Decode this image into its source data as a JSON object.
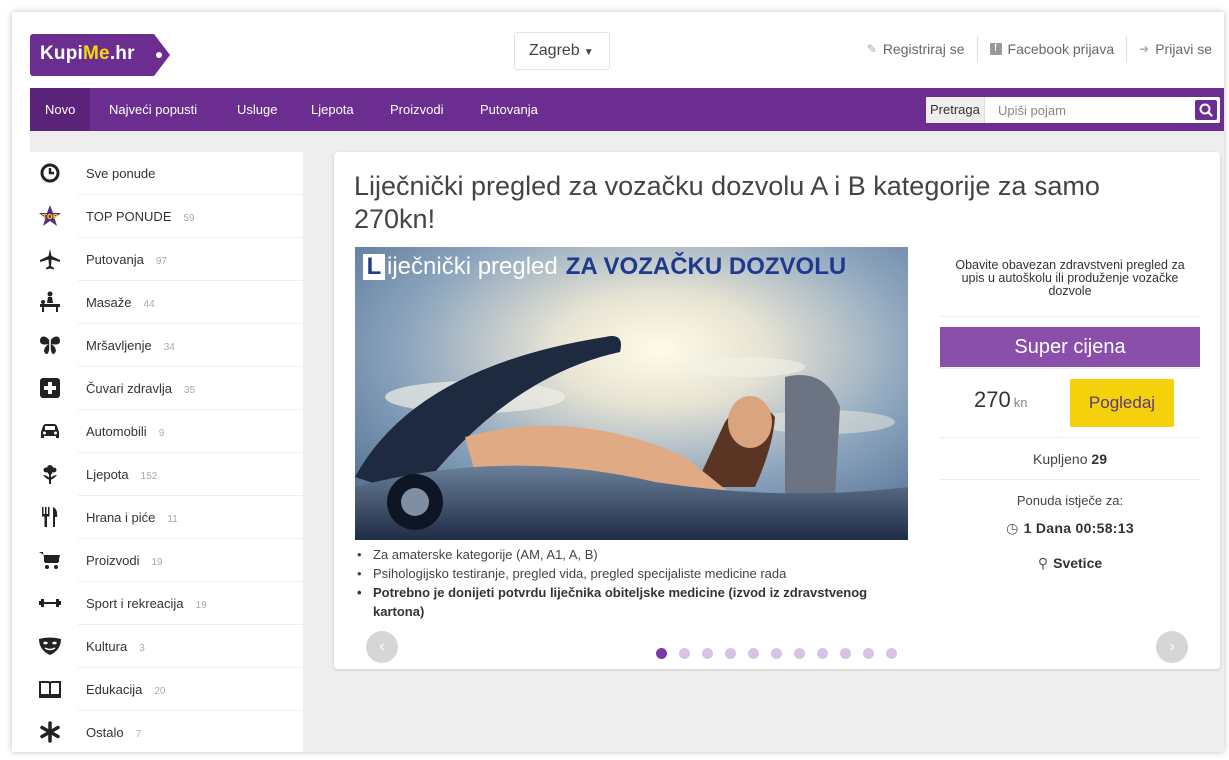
{
  "header": {
    "logo": {
      "part1": "Kupi",
      "part2": "Me",
      "part3": ".hr"
    },
    "city": "Zagreb",
    "links": [
      {
        "icon": "edit-icon",
        "label": "Registriraj se"
      },
      {
        "icon": "facebook-icon",
        "label": "Facebook prijava"
      },
      {
        "icon": "sign-in-icon",
        "label": "Prijavi se"
      }
    ]
  },
  "nav": {
    "items": [
      "Novo",
      "Najveći popusti",
      "Usluge",
      "Ljepota",
      "Proizvodi",
      "Putovanja"
    ],
    "active": "Novo",
    "accent": "#6b2d8f",
    "search": {
      "label": "Pretraga",
      "placeholder": "Upiši pojam"
    }
  },
  "sidebar": {
    "items": [
      {
        "name": "Sve ponude",
        "count": "",
        "icon": "clock-icon"
      },
      {
        "name": "TOP PONUDE",
        "count": "59",
        "icon": "top-star-icon"
      },
      {
        "name": "Putovanja",
        "count": "97",
        "icon": "plane-icon"
      },
      {
        "name": "Masaže",
        "count": "44",
        "icon": "massage-icon"
      },
      {
        "name": "Mršavljenje",
        "count": "34",
        "icon": "butterfly-icon"
      },
      {
        "name": "Čuvari zdravlja",
        "count": "35",
        "icon": "medical-cross-icon"
      },
      {
        "name": "Automobili",
        "count": "9",
        "icon": "car-icon"
      },
      {
        "name": "Ljepota",
        "count": "152",
        "icon": "flower-icon"
      },
      {
        "name": "Hrana i piće",
        "count": "11",
        "icon": "cutlery-icon"
      },
      {
        "name": "Proizvodi",
        "count": "19",
        "icon": "cart-icon"
      },
      {
        "name": "Sport i rekreacija",
        "count": "19",
        "icon": "dumbbell-icon"
      },
      {
        "name": "Kultura",
        "count": "3",
        "icon": "masks-icon"
      },
      {
        "name": "Edukacija",
        "count": "20",
        "icon": "book-icon"
      },
      {
        "name": "Ostalo",
        "count": "7",
        "icon": "asterisk-icon"
      }
    ]
  },
  "deal": {
    "title": "Liječnički pregled za vozačku dozvolu A i B kategorije za samo 270kn!",
    "image_caption": {
      "letter": "L",
      "part1": "iječnički pregled",
      "part2": "ZA VOZAČKU DOZVOLU"
    },
    "bullets": [
      {
        "text": "Za amaterske kategorije (AM, A1, A, B)",
        "bold": false
      },
      {
        "text": "Psihologijsko testiranje, pregled vida, pregled specijaliste medicine rada",
        "bold": false
      },
      {
        "text": "Potrebno je donijeti potvrdu liječnika obiteljske medicine (izvod iz zdravstvenog kartona)",
        "bold": true
      }
    ],
    "carousel": {
      "total": 11,
      "active": 1
    },
    "description": "Obavite obavezan zdravstveni pregled za upis u autoškolu ili produženje vozačke dozvole",
    "badge": "Super cijena",
    "price": "270",
    "currency": "kn",
    "buy_label": "Pogledaj",
    "bought_label": "Kupljeno",
    "bought_count": "29",
    "expires_label": "Ponuda istječe za:",
    "timer": "1 Dana  00:58:13",
    "location": "Svetice"
  }
}
